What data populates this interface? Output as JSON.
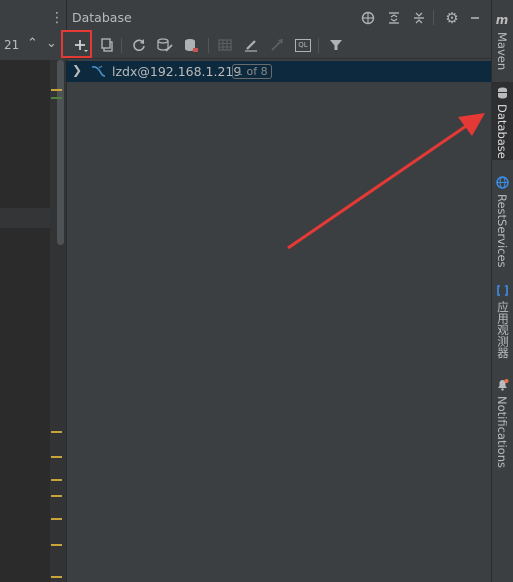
{
  "editor": {
    "line_count": "21",
    "up_icon": "chevron-up-icon",
    "down_icon": "chevron-down-icon"
  },
  "panel": {
    "title": "Database",
    "header_icons": [
      "globe-icon",
      "expand-all-icon",
      "collapse-all-icon",
      "gear-icon",
      "minimize-icon"
    ],
    "toolbar_icons": [
      "add-icon",
      "copy-icon",
      "refresh-icon",
      "schema-settings-icon",
      "database-icon",
      "table-icon",
      "edit-icon",
      "jump-icon",
      "sql-console-icon",
      "filter-icon"
    ],
    "sql_console_label": "QL"
  },
  "tree": {
    "items": [
      {
        "label": "lzdx@192.168.1.219",
        "badge": "1 of 8",
        "expanded": false
      }
    ]
  },
  "right_strip": {
    "tabs": [
      {
        "label": "Maven",
        "icon": "maven-icon",
        "icon_glyph": "m"
      },
      {
        "label": "Database",
        "icon": "database-icon",
        "active": true
      },
      {
        "label": "RestServices",
        "icon": "globe-icon"
      },
      {
        "label": "应用观测器",
        "icon": "observer-icon"
      },
      {
        "label": "Notifications",
        "icon": "bell-icon"
      }
    ]
  },
  "colors": {
    "highlight_box": "#e53935",
    "arrow": "#e53935",
    "selection": "#0d293e"
  }
}
